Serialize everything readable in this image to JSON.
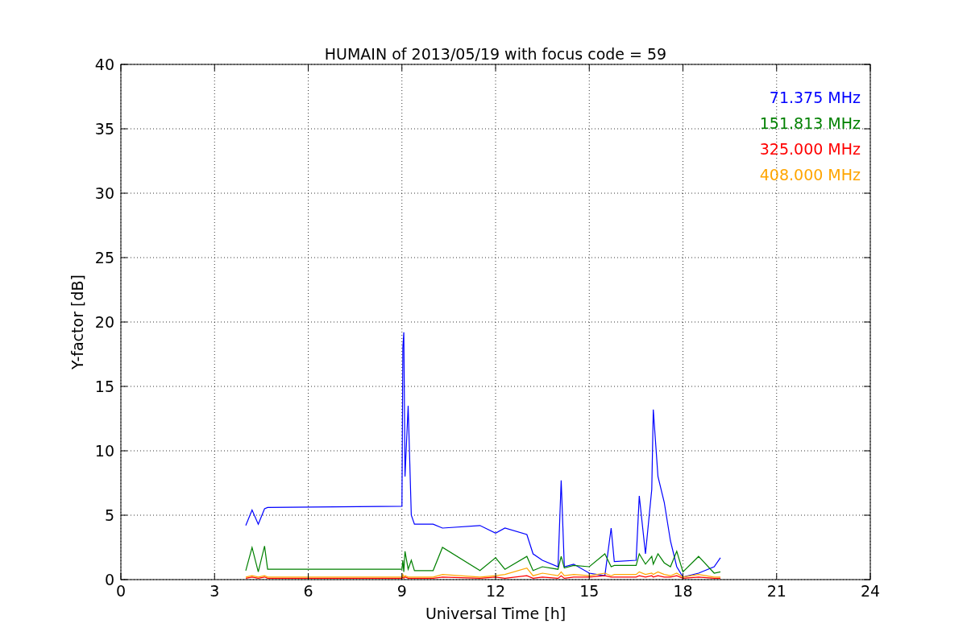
{
  "figure": {
    "chart_data": {
      "type": "line",
      "title": "HUMAIN of 2013/05/19 with focus code = 59",
      "xlabel": "Universal Time [h]",
      "ylabel": "Y-factor [dB]",
      "xlim": [
        0,
        24
      ],
      "ylim": [
        0,
        40
      ],
      "xticks": [
        0,
        3,
        6,
        9,
        12,
        15,
        18,
        21,
        24
      ],
      "yticks": [
        0,
        5,
        10,
        15,
        20,
        25,
        30,
        35,
        40
      ],
      "grid": true,
      "x": [
        4,
        4.2,
        4.4,
        4.6,
        4.7,
        9.0,
        9.03,
        9.06,
        9.1,
        9.2,
        9.3,
        9.4,
        10,
        10.3,
        11.5,
        12,
        12.3,
        13,
        13.2,
        13.5,
        14,
        14.1,
        14.2,
        14.5,
        15,
        15.5,
        15.7,
        15.8,
        16.5,
        16.6,
        16.8,
        17,
        17.05,
        17.2,
        17.4,
        17.6,
        17.8,
        18,
        18.5,
        19,
        19.2
      ],
      "series": [
        {
          "name": "71.375 MHz",
          "color": "#0000ff",
          "values": [
            4.2,
            5.4,
            4.3,
            5.5,
            5.6,
            5.7,
            18,
            19.2,
            8,
            13.5,
            5,
            4.3,
            4.3,
            4,
            4.2,
            3.6,
            4,
            3.5,
            2,
            1.5,
            1,
            7.7,
            1,
            1.2,
            0.5,
            0.3,
            4,
            1.4,
            1.5,
            6.5,
            2,
            7,
            13.2,
            8,
            6,
            3,
            1,
            0.2,
            0.5,
            1,
            1.7
          ]
        },
        {
          "name": "151.813 MHz",
          "color": "#008000",
          "values": [
            0.7,
            2.5,
            0.6,
            2.6,
            0.8,
            0.8,
            1.5,
            0.6,
            2.2,
            0.8,
            1.5,
            0.7,
            0.7,
            2.5,
            0.7,
            1.7,
            0.8,
            1.8,
            0.7,
            1,
            0.8,
            1.8,
            0.9,
            1.1,
            1,
            2,
            1,
            1.1,
            1.1,
            2,
            1.2,
            1.8,
            1.2,
            2,
            1.3,
            1,
            2.2,
            0.6,
            1.8,
            0.5,
            0.6
          ]
        },
        {
          "name": "325.000 MHz",
          "color": "#ff0000",
          "values": [
            0.1,
            0.2,
            0.1,
            0.2,
            0.1,
            0.1,
            0.2,
            0.1,
            0.2,
            0.1,
            0.1,
            0.1,
            0.1,
            0.2,
            0.1,
            0.2,
            0.1,
            0.3,
            0.1,
            0.2,
            0.1,
            0.3,
            0.1,
            0.2,
            0.2,
            0.3,
            0.2,
            0.2,
            0.2,
            0.3,
            0.2,
            0.3,
            0.2,
            0.3,
            0.2,
            0.2,
            0.3,
            0.1,
            0.2,
            0.1,
            0.1
          ]
        },
        {
          "name": "408.000 MHz",
          "color": "#ffa500",
          "values": [
            0.2,
            0.3,
            0.2,
            0.3,
            0.2,
            0.2,
            0.4,
            0.2,
            0.3,
            0.2,
            0.2,
            0.2,
            0.2,
            0.4,
            0.2,
            0.3,
            0.4,
            0.9,
            0.3,
            0.5,
            0.3,
            0.6,
            0.3,
            0.4,
            0.3,
            0.5,
            0.3,
            0.4,
            0.4,
            0.6,
            0.4,
            0.5,
            0.4,
            0.6,
            0.4,
            0.3,
            0.5,
            0.2,
            0.4,
            0.2,
            0.2
          ]
        }
      ]
    }
  }
}
